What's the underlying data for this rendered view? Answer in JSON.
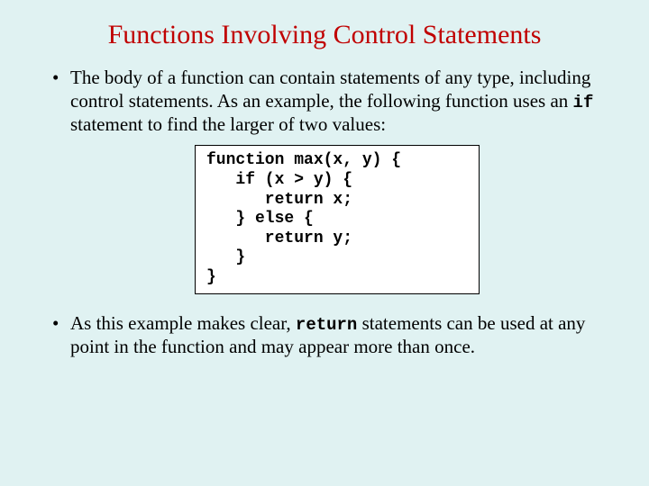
{
  "title": "Functions Involving Control Statements",
  "bullets": {
    "b1_part1": "The body of a function can contain statements of any type, including control statements.  As an example, the following function uses an ",
    "b1_code": "if",
    "b1_part2": " statement to find the larger of two values:",
    "b2_part1": "As this example makes clear, ",
    "b2_code": "return",
    "b2_part2": " statements can be used at any point in the function and may appear more than once."
  },
  "code": "function max(x, y) {\n   if (x > y) {\n      return x;\n   } else {\n      return y;\n   }\n}"
}
